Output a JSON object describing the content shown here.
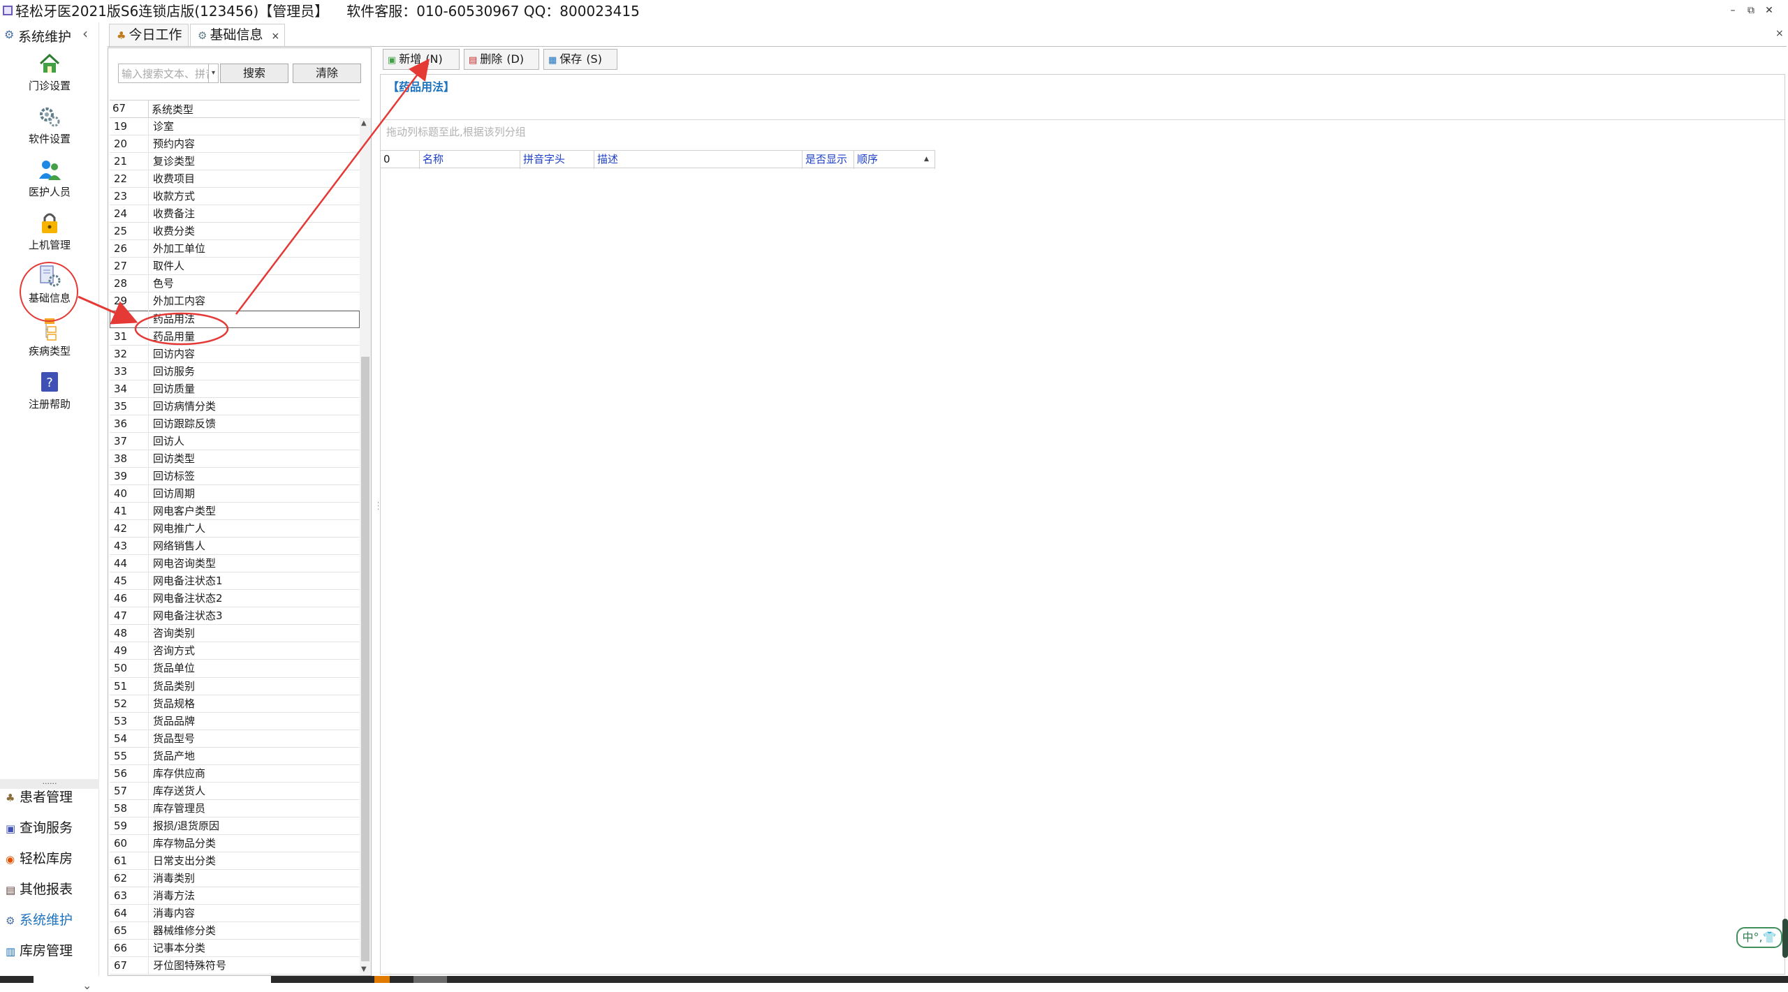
{
  "window": {
    "title": "轻松牙医2021版S6连锁店版(123456)【管理员】",
    "support": "软件客服：010-60530967 QQ：800023415",
    "minimize": "–",
    "restore": "⧉",
    "close": "✕"
  },
  "nav": {
    "title": "系统维护",
    "collapse": "‹",
    "items": [
      {
        "label": "门诊设置",
        "icon": "house-icon"
      },
      {
        "label": "软件设置",
        "icon": "gears-icon"
      },
      {
        "label": "医护人员",
        "icon": "people-icon"
      },
      {
        "label": "上机管理",
        "icon": "lock-icon"
      },
      {
        "label": "基础信息",
        "icon": "settings-document-icon"
      },
      {
        "label": "疾病类型",
        "icon": "tree-icon"
      },
      {
        "label": "注册帮助",
        "icon": "help-icon"
      }
    ],
    "dots": "......",
    "sections": [
      {
        "label": "患者管理"
      },
      {
        "label": "查询服务"
      },
      {
        "label": "轻松库房"
      },
      {
        "label": "其他报表"
      },
      {
        "label": "系统维护"
      },
      {
        "label": "库房管理"
      }
    ],
    "bottom_chevron": "⌄"
  },
  "tabs": [
    {
      "label": "今日工作"
    },
    {
      "label": "基础信息",
      "close": "×"
    }
  ],
  "content_close": "×",
  "left_panel": {
    "search_placeholder": "输入搜索文本、拼音首字母",
    "search_button": "搜索",
    "clear_button": "清除",
    "count_header": "67",
    "type_header": "系统类型",
    "rows": [
      {
        "num": "19",
        "name": "诊室"
      },
      {
        "num": "20",
        "name": "预约内容"
      },
      {
        "num": "21",
        "name": "复诊类型"
      },
      {
        "num": "22",
        "name": "收费项目"
      },
      {
        "num": "23",
        "name": "收款方式"
      },
      {
        "num": "24",
        "name": "收费备注"
      },
      {
        "num": "25",
        "name": "收费分类"
      },
      {
        "num": "26",
        "name": "外加工单位"
      },
      {
        "num": "27",
        "name": "取件人"
      },
      {
        "num": "28",
        "name": "色号"
      },
      {
        "num": "29",
        "name": "外加工内容"
      },
      {
        "num": "30",
        "name": "药品用法"
      },
      {
        "num": "31",
        "name": "药品用量"
      },
      {
        "num": "32",
        "name": "回访内容"
      },
      {
        "num": "33",
        "name": "回访服务"
      },
      {
        "num": "34",
        "name": "回访质量"
      },
      {
        "num": "35",
        "name": "回访病情分类"
      },
      {
        "num": "36",
        "name": "回访跟踪反馈"
      },
      {
        "num": "37",
        "name": "回访人"
      },
      {
        "num": "38",
        "name": "回访类型"
      },
      {
        "num": "39",
        "name": "回访标签"
      },
      {
        "num": "40",
        "name": "回访周期"
      },
      {
        "num": "41",
        "name": "网电客户类型"
      },
      {
        "num": "42",
        "name": "网电推广人"
      },
      {
        "num": "43",
        "name": "网络销售人"
      },
      {
        "num": "44",
        "name": "网电咨询类型"
      },
      {
        "num": "45",
        "name": "网电备注状态1"
      },
      {
        "num": "46",
        "name": "网电备注状态2"
      },
      {
        "num": "47",
        "name": "网电备注状态3"
      },
      {
        "num": "48",
        "name": "咨询类别"
      },
      {
        "num": "49",
        "name": "咨询方式"
      },
      {
        "num": "50",
        "name": "货品单位"
      },
      {
        "num": "51",
        "name": "货品类别"
      },
      {
        "num": "52",
        "name": "货品规格"
      },
      {
        "num": "53",
        "name": "货品品牌"
      },
      {
        "num": "54",
        "name": "货品型号"
      },
      {
        "num": "55",
        "name": "货品产地"
      },
      {
        "num": "56",
        "name": "库存供应商"
      },
      {
        "num": "57",
        "name": "库存送货人"
      },
      {
        "num": "58",
        "name": "库存管理员"
      },
      {
        "num": "59",
        "name": "报损/退货原因"
      },
      {
        "num": "60",
        "name": "库存物品分类"
      },
      {
        "num": "61",
        "name": "日常支出分类"
      },
      {
        "num": "62",
        "name": "消毒类别"
      },
      {
        "num": "63",
        "name": "消毒方法"
      },
      {
        "num": "64",
        "name": "消毒内容"
      },
      {
        "num": "65",
        "name": "器械维修分类"
      },
      {
        "num": "66",
        "name": "记事本分类"
      },
      {
        "num": "67",
        "name": "牙位图特殊符号"
      }
    ],
    "selected_num": "30"
  },
  "toolbar": {
    "add": {
      "label": "新增",
      "key": "(N)"
    },
    "delete": {
      "label": "删除",
      "key": "(D)"
    },
    "save": {
      "label": "保存",
      "key": "(S)"
    }
  },
  "detail": {
    "group_title": "【药品用法】",
    "group_hint": "拖动列标题至此,根据该列分组",
    "columns": {
      "count": "0",
      "name": "名称",
      "pinyin": "拼音字头",
      "desc": "描述",
      "show": "是否显示",
      "order": "顺序"
    }
  },
  "ime": "中°,👕",
  "colors": {
    "accent": "#1e73be",
    "annotation": "#e53935"
  }
}
